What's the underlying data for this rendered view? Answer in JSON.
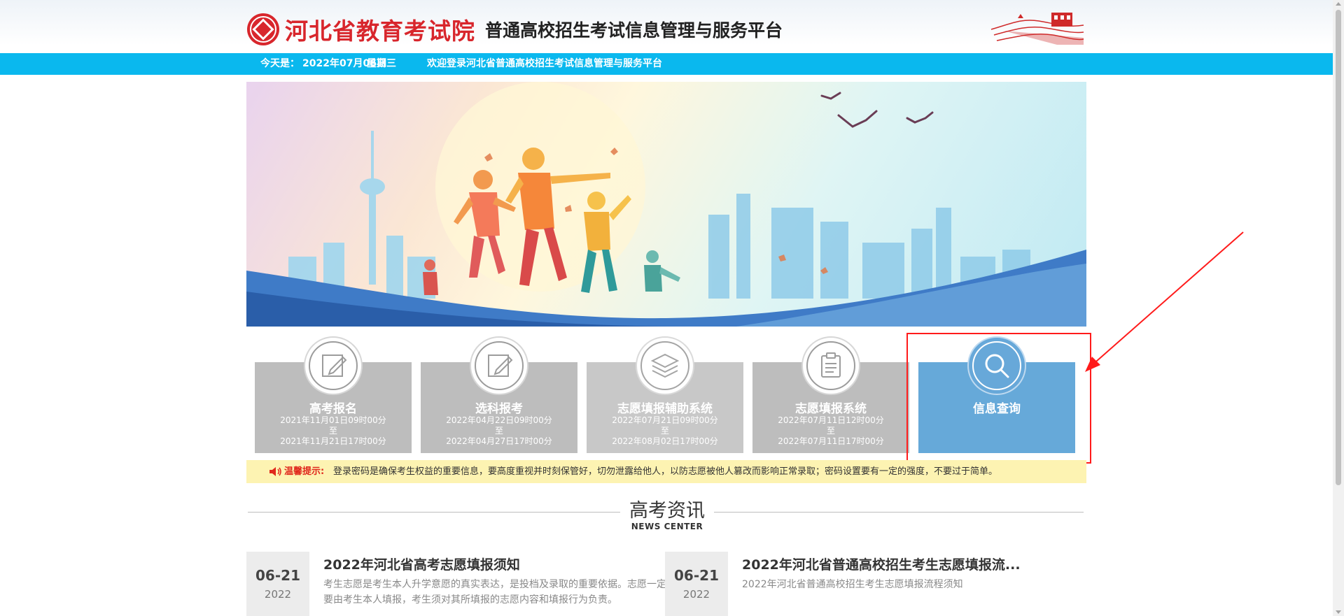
{
  "header": {
    "logo_name": "河北省教育考试院",
    "platform_name": "普通高校招生考试信息管理与服务平台"
  },
  "topbar": {
    "today_label": "今天是：",
    "date": "2022年07月06日",
    "weekday": "星期三",
    "welcome": "欢迎登录河北省普通高校招生考试信息管理与服务平台"
  },
  "cards": [
    {
      "title": "高考报名",
      "start": "2021年11月01日09时00分",
      "to": "至",
      "end": "2021年11月21日17时00分",
      "icon": "edit-icon"
    },
    {
      "title": "选科报考",
      "start": "2022年04月22日09时00分",
      "to": "至",
      "end": "2022年04月27日17时00分",
      "icon": "edit-icon"
    },
    {
      "title": "志愿填报辅助系统",
      "start": "2022年07月21日09时00分",
      "to": "至",
      "end": "2022年08月02日17时00分",
      "icon": "layers-icon"
    },
    {
      "title": "志愿填报系统",
      "start": "2022年07月11日12时00分",
      "to": "至",
      "end": "2022年07月11日17时00分",
      "icon": "clipboard-icon"
    },
    {
      "title": "信息查询",
      "icon": "search-icon"
    }
  ],
  "notice": {
    "label": "温馨提示:",
    "text": "登录密码是确保考生权益的重要信息，要高度重视并时刻保管好，切勿泄露给他人，以防志愿被他人篡改而影响正常录取；密码设置要有一定的强度，不要过于简单。"
  },
  "news": {
    "title": "高考资讯",
    "subtitle": "NEWS CENTER",
    "items": [
      {
        "date": "06-21",
        "year": "2022",
        "title": "2022年河北省高考志愿填报须知",
        "desc": "考生志愿是考生本人升学意愿的真实表达，是投档及录取的重要依据。志愿一定要由考生本人填报，考生须对其所填报的志愿内容和填报行为负责。"
      },
      {
        "date": "06-21",
        "year": "2022",
        "title": "2022年河北省普通高校招生考生志愿填报流...",
        "desc": "2022年河北省普通高校招生考生志愿填报流程须知"
      }
    ]
  },
  "colors": {
    "brand_red": "#d8262c",
    "topbar_blue": "#0ab8ee",
    "card_gray": "#bdbdbd",
    "card_active": "#66a9d9",
    "annotation_red": "#ff1b1b"
  }
}
